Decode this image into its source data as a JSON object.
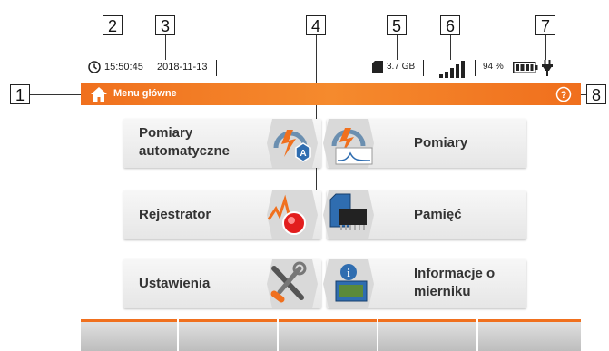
{
  "callouts": [
    "1",
    "2",
    "3",
    "4",
    "5",
    "6",
    "7",
    "8"
  ],
  "status": {
    "time": "15:50:45",
    "date": "2018-11-13",
    "memory": "3.7 GB",
    "battery": "94 %"
  },
  "menubar": {
    "title": "Menu główne"
  },
  "tiles": {
    "auto": [
      "Pomiary",
      "automatyczne"
    ],
    "measurements": "Pomiary",
    "recorder": "Rejestrator",
    "memory": "Pamięć",
    "settings": "Ustawienia",
    "info": [
      "Informacje o",
      "mierniku"
    ]
  },
  "colors": {
    "accent": "#f0701e"
  },
  "icons": [
    "home-icon",
    "clock-icon",
    "sd-card-icon",
    "signal-icon",
    "battery-icon",
    "plug-icon",
    "help-icon"
  ]
}
